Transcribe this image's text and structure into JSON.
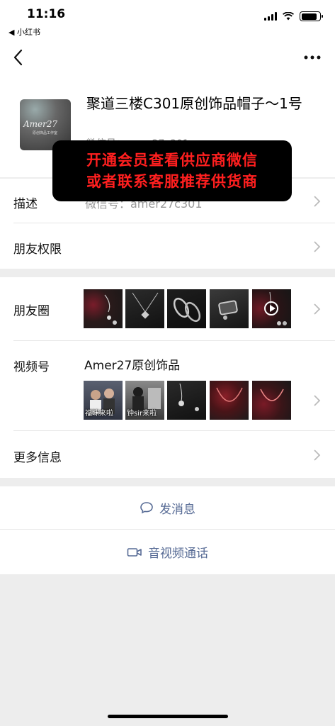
{
  "status_bar": {
    "time": "11:16",
    "back_app": "◀ 小红书"
  },
  "profile": {
    "name": "聚道三楼C301原创饰品帽子～1号",
    "wechat_id": "微信号：amer27c301",
    "avatar_text": "Amer27",
    "avatar_subtext": "原创饰品工作室"
  },
  "banner": {
    "line1": "开通会员查看供应商微信",
    "line2": "或者联系客服推荐供货商"
  },
  "rows": {
    "description": {
      "label": "描述",
      "value": "微信号：amer27c301"
    },
    "friend_permission": {
      "label": "朋友权限"
    },
    "moments": {
      "label": "朋友圈"
    },
    "channels": {
      "label": "视频号",
      "name": "Amer27原创饰品",
      "captions": [
        "福眯来啦",
        "钟sir来啦"
      ]
    },
    "more_info": {
      "label": "更多信息"
    }
  },
  "actions": {
    "send_message": "发消息",
    "video_call": "音视频通话"
  },
  "colors": {
    "link": "#576b95",
    "banner_text": "#ff1f1f",
    "background": "#ededed"
  },
  "icons": [
    "back-arrow-icon",
    "more-icon",
    "chevron-right-icon",
    "play-icon",
    "message-bubble-icon",
    "video-camera-icon"
  ]
}
